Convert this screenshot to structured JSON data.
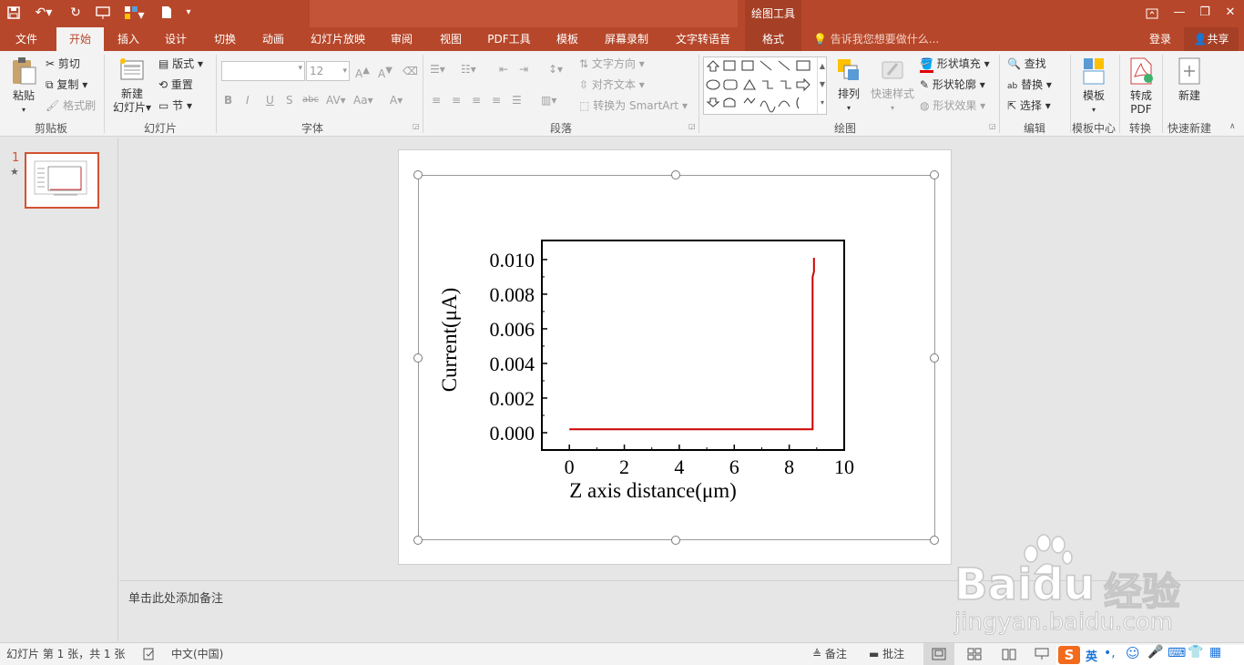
{
  "titlebar": {
    "context_title": "绘图工具",
    "login": "登录",
    "share": "共享"
  },
  "tabs": [
    {
      "label": "文件"
    },
    {
      "label": "开始"
    },
    {
      "label": "插入"
    },
    {
      "label": "设计"
    },
    {
      "label": "切换"
    },
    {
      "label": "动画"
    },
    {
      "label": "幻灯片放映"
    },
    {
      "label": "审阅"
    },
    {
      "label": "视图"
    },
    {
      "label": "PDF工具"
    },
    {
      "label": "模板"
    },
    {
      "label": "屏幕录制"
    },
    {
      "label": "文字转语音"
    },
    {
      "label": "格式"
    }
  ],
  "tell_me": "告诉我您想要做什么...",
  "ribbon": {
    "clipboard": {
      "paste": "粘贴",
      "cut": "剪切",
      "copy": "复制",
      "format_painter": "格式刷",
      "label": "剪贴板"
    },
    "slides": {
      "new_slide_l1": "新建",
      "new_slide_l2": "幻灯片",
      "layout": "版式",
      "reset": "重置",
      "section": "节",
      "label": "幻灯片"
    },
    "font": {
      "font_name": "",
      "font_size": "12",
      "label": "字体"
    },
    "paragraph": {
      "text_direction": "文字方向",
      "align_text": "对齐文本",
      "smartart": "转换为 SmartArt",
      "label": "段落"
    },
    "drawing": {
      "arrange": "排列",
      "quick_styles": "快速样式",
      "shape_fill": "形状填充",
      "shape_outline": "形状轮廓",
      "shape_effects": "形状效果",
      "label": "绘图"
    },
    "editing": {
      "find": "查找",
      "replace": "替换",
      "select": "选择",
      "label": "编辑"
    },
    "template_center": {
      "btn": "模板",
      "label": "模板中心"
    },
    "convert": {
      "btn_l1": "转成",
      "btn_l2": "PDF",
      "label": "转换"
    },
    "quick_new": {
      "btn": "新建",
      "label": "快速新建"
    }
  },
  "thumbnail": {
    "number": "1",
    "star": "★"
  },
  "notes_placeholder": "单击此处添加备注",
  "status": {
    "slide_info": "幻灯片 第 1 张，共 1 张",
    "language": "中文(中国)",
    "notes": "备注",
    "comments": "批注",
    "ime": "英"
  },
  "watermark": {
    "brand": "Bai",
    "brand2": "du",
    "cn": "经验",
    "url": "jingyan.baidu.com"
  },
  "colors": {
    "accent": "#b7472a",
    "series": "#cc0000"
  },
  "chart_data": {
    "type": "line",
    "xlabel": "Z axis distance(μm)",
    "ylabel": "Current(μA)",
    "xlim": [
      -1,
      10
    ],
    "ylim": [
      -0.001,
      0.0111
    ],
    "xticks": [
      "0",
      "2",
      "4",
      "6",
      "8",
      "10"
    ],
    "yticks": [
      "0.000",
      "0.002",
      "0.004",
      "0.006",
      "0.008",
      "0.010"
    ],
    "series": [
      {
        "x": [
          0,
          2,
          4,
          6,
          8,
          8.85,
          8.85,
          8.9,
          8.9
        ],
        "y": [
          0.0002,
          0.0002,
          0.0002,
          0.0002,
          0.0002,
          0.0002,
          0.009,
          0.0093,
          0.0101
        ]
      }
    ]
  }
}
